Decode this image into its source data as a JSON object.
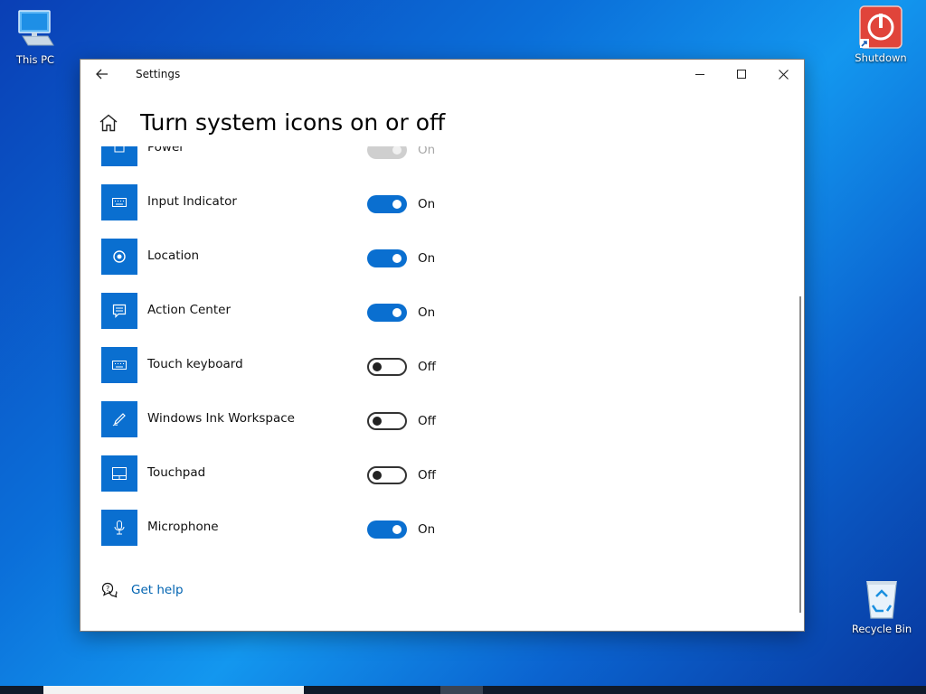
{
  "desktop": {
    "icons": [
      {
        "name": "this-pc",
        "label": "This PC"
      },
      {
        "name": "shutdown",
        "label": "Shutdown"
      },
      {
        "name": "recycle-bin",
        "label": "Recycle Bin"
      }
    ]
  },
  "window": {
    "title": "Settings",
    "page_title": "Turn system icons on or off",
    "items": [
      {
        "label": "Power",
        "state": "On",
        "on": true,
        "disabled": true,
        "icon": "power-icon"
      },
      {
        "label": "Input Indicator",
        "state": "On",
        "on": true,
        "icon": "keyboard-icon"
      },
      {
        "label": "Location",
        "state": "On",
        "on": true,
        "icon": "location-icon"
      },
      {
        "label": "Action Center",
        "state": "On",
        "on": true,
        "icon": "action-center-icon"
      },
      {
        "label": "Touch keyboard",
        "state": "Off",
        "on": false,
        "icon": "keyboard-icon"
      },
      {
        "label": "Windows Ink Workspace",
        "state": "Off",
        "on": false,
        "icon": "pen-icon"
      },
      {
        "label": "Touchpad",
        "state": "Off",
        "on": false,
        "icon": "touchpad-icon"
      },
      {
        "label": "Microphone",
        "state": "On",
        "on": true,
        "icon": "microphone-icon"
      }
    ],
    "help_link": "Get help"
  },
  "colors": {
    "accent": "#0a6fd0",
    "link": "#0063b1"
  }
}
